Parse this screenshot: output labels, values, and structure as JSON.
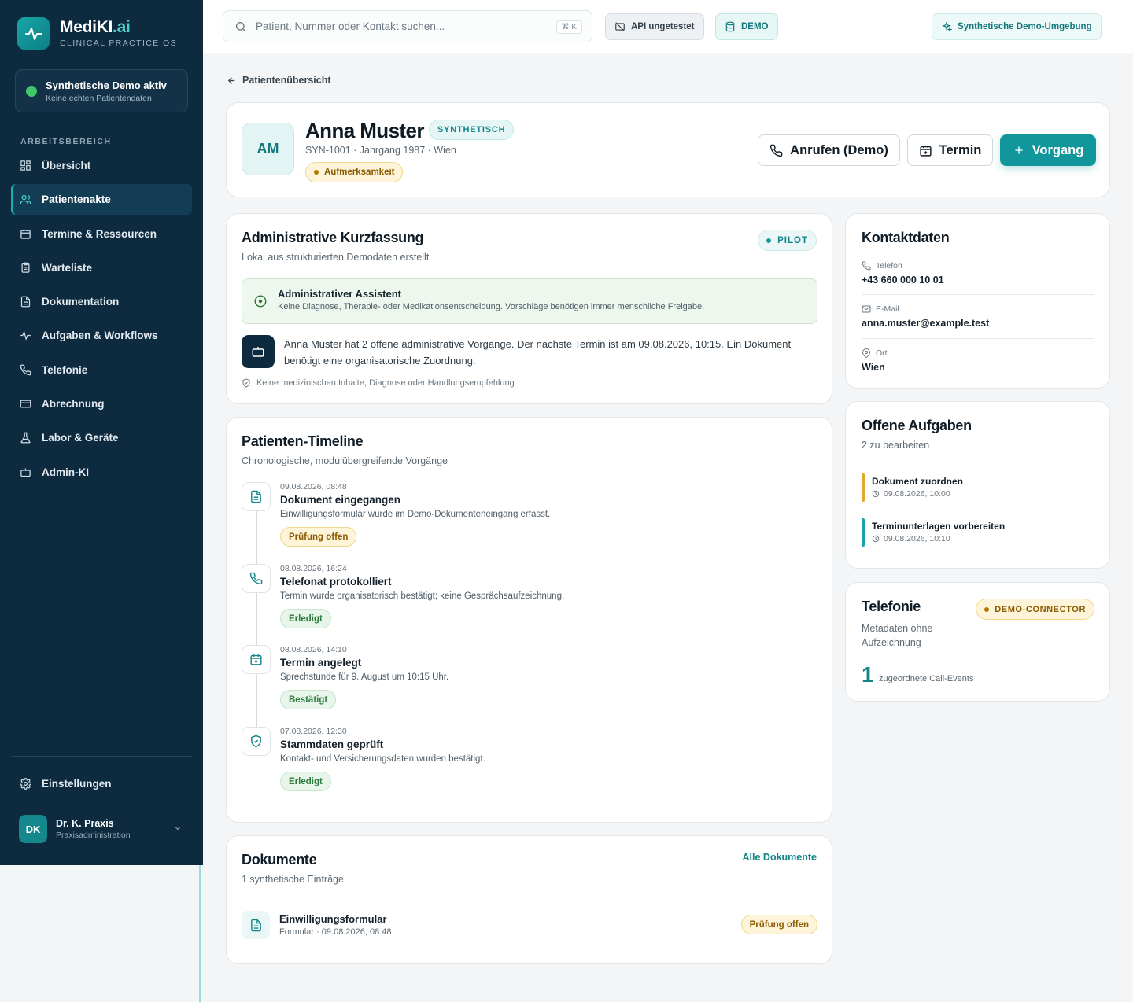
{
  "brand": {
    "name": "MediKI",
    "name_suffix": ".ai",
    "subtitle": "CLINICAL PRACTICE OS"
  },
  "demo_status": {
    "title": "Synthetische Demo aktiv",
    "subtitle": "Keine echten Patientendaten"
  },
  "sidebar": {
    "section_label": "ARBEITSBEREICH",
    "items": [
      {
        "label": "Übersicht",
        "icon": "grid-icon"
      },
      {
        "label": "Patientenakte",
        "icon": "users-icon",
        "active": true
      },
      {
        "label": "Termine & Ressourcen",
        "icon": "calendar-icon"
      },
      {
        "label": "Warteliste",
        "icon": "clipboard-icon"
      },
      {
        "label": "Dokumentation",
        "icon": "document-icon"
      },
      {
        "label": "Aufgaben & Workflows",
        "icon": "activity-icon"
      },
      {
        "label": "Telefonie",
        "icon": "phone-icon"
      },
      {
        "label": "Abrechnung",
        "icon": "credit-card-icon"
      },
      {
        "label": "Labor & Geräte",
        "icon": "flask-icon"
      },
      {
        "label": "Admin-KI",
        "icon": "bot-icon"
      }
    ],
    "settings_label": "Einstellungen"
  },
  "user": {
    "initials": "DK",
    "name": "Dr. K. Praxis",
    "role": "Praxisadministration"
  },
  "topbar": {
    "search_placeholder": "Patient, Nummer oder Kontakt suchen...",
    "shortcut": "⌘ K",
    "api_status": "API ungetestet",
    "demo_badge": "DEMO",
    "environment": "Synthetische Demo-Umgebung"
  },
  "back_link": "Patientenübersicht",
  "patient": {
    "initials": "AM",
    "name": "Anna Muster",
    "badge": "SYNTHETISCH",
    "meta": "SYN-1001 · Jahrgang 1987 · Wien",
    "flag": "Aufmerksamkeit"
  },
  "actions": {
    "call": "Anrufen (Demo)",
    "appointment": "Termin",
    "new_case": "Vorgang"
  },
  "summary": {
    "title": "Administrative Kurzfassung",
    "subtitle": "Lokal aus strukturierten Demodaten erstellt",
    "badge": "PILOT",
    "assistant_title": "Administrativer Assistent",
    "assistant_note": "Keine Diagnose, Therapie- oder Medikationsentscheidung. Vorschläge benötigen immer menschliche Freigabe.",
    "text": "Anna Muster hat 2 offene administrative Vorgänge. Der nächste Termin ist am 09.08.2026, 10:15. Ein Dokument benötigt eine organisatorische Zuordnung.",
    "disclaimer": "Keine medizinischen Inhalte, Diagnose oder Handlungsempfehlung"
  },
  "timeline": {
    "title": "Patienten-Timeline",
    "subtitle": "Chronologische, modulübergreifende Vorgänge",
    "events": [
      {
        "time": "09.08.2026, 08:48",
        "title": "Dokument eingegangen",
        "desc": "Einwilligungsformular wurde im Demo-Dokumenteneingang erfasst.",
        "status": "Prüfung offen",
        "icon": "document-icon"
      },
      {
        "time": "08.08.2026, 16:24",
        "title": "Telefonat protokolliert",
        "desc": "Termin wurde organisatorisch bestätigt; keine Gesprächsaufzeichnung.",
        "status": "Erledigt",
        "icon": "phone-icon"
      },
      {
        "time": "08.08.2026, 14:10",
        "title": "Termin angelegt",
        "desc": "Sprechstunde für 9. August um 10:15 Uhr.",
        "status": "Bestätigt",
        "icon": "calendar-plus-icon"
      },
      {
        "time": "07.08.2026, 12:30",
        "title": "Stammdaten geprüft",
        "desc": "Kontakt- und Versicherungsdaten wurden bestätigt.",
        "status": "Erledigt",
        "icon": "shield-check-icon"
      }
    ]
  },
  "documents": {
    "title": "Dokumente",
    "subtitle": "1 synthetische Einträge",
    "link": "Alle Dokumente",
    "items": [
      {
        "name": "Einwilligungsformular",
        "meta": "Formular · 09.08.2026, 08:48",
        "status": "Prüfung offen"
      }
    ]
  },
  "contact": {
    "title": "Kontaktdaten",
    "phone_label": "Telefon",
    "phone": "+43 660 000 10 01",
    "email_label": "E-Mail",
    "email": "anna.muster@example.test",
    "location_label": "Ort",
    "location": "Wien"
  },
  "tasks": {
    "title": "Offene Aufgaben",
    "subtitle": "2 zu bearbeiten",
    "items": [
      {
        "title": "Dokument zuordnen",
        "time": "09.08.2026, 10:00",
        "color": "#e2a72b"
      },
      {
        "title": "Terminunterlagen vorbereiten",
        "time": "09.08.2026, 10:10",
        "color": "#1aa3a6"
      }
    ]
  },
  "telephony": {
    "title": "Telefonie",
    "badge": "DEMO-CONNECTOR",
    "subtitle": "Metadaten ohne Aufzeichnung",
    "count": "1",
    "count_label": "zugeordnete Call-Events"
  }
}
